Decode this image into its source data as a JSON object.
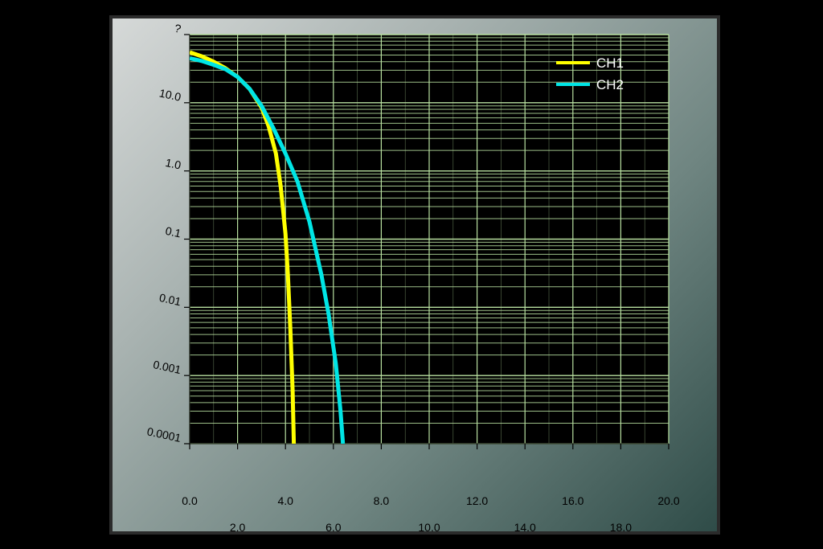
{
  "chart_data": {
    "type": "line",
    "title": "",
    "xlabel": "",
    "ylabel": "",
    "x_scale": "linear",
    "y_scale": "log",
    "xlim": [
      0,
      20
    ],
    "ylim": [
      0.0001,
      100
    ],
    "grid": true,
    "legend_position": "top-right",
    "background_color": "#000000",
    "grid_color": "#b8e0a0",
    "x_ticks": {
      "row1": [
        "0.0",
        "4.0",
        "8.0",
        "12.0",
        "16.0",
        "20.0"
      ],
      "row2": [
        "2.0",
        "6.0",
        "10.0",
        "14.0",
        "18.0"
      ]
    },
    "y_tick_labels": [
      "?",
      "10.0",
      "1.0",
      "0.1",
      "0.01",
      "0.001",
      "0.0001"
    ],
    "series": [
      {
        "name": "CH1",
        "color": "#ffff00",
        "points": [
          [
            0,
            55
          ],
          [
            0.5,
            48
          ],
          [
            1,
            40
          ],
          [
            1.5,
            32
          ],
          [
            2,
            24
          ],
          [
            2.5,
            16
          ],
          [
            3,
            8.5
          ],
          [
            3.3,
            4.5
          ],
          [
            3.6,
            1.8
          ],
          [
            3.8,
            0.6
          ],
          [
            4.0,
            0.12
          ],
          [
            4.1,
            0.03
          ],
          [
            4.2,
            0.005
          ],
          [
            4.3,
            0.0006
          ],
          [
            4.35,
            0.0001
          ]
        ]
      },
      {
        "name": "CH2",
        "color": "#00e5e5",
        "points": [
          [
            0,
            45
          ],
          [
            0.5,
            41
          ],
          [
            1,
            36
          ],
          [
            1.5,
            31
          ],
          [
            2,
            24
          ],
          [
            2.5,
            16
          ],
          [
            3,
            9
          ],
          [
            3.5,
            4.2
          ],
          [
            4,
            1.8
          ],
          [
            4.5,
            0.7
          ],
          [
            5,
            0.18
          ],
          [
            5.5,
            0.03
          ],
          [
            5.8,
            0.008
          ],
          [
            6.1,
            0.0015
          ],
          [
            6.3,
            0.0003
          ],
          [
            6.4,
            0.0001
          ]
        ]
      }
    ]
  }
}
